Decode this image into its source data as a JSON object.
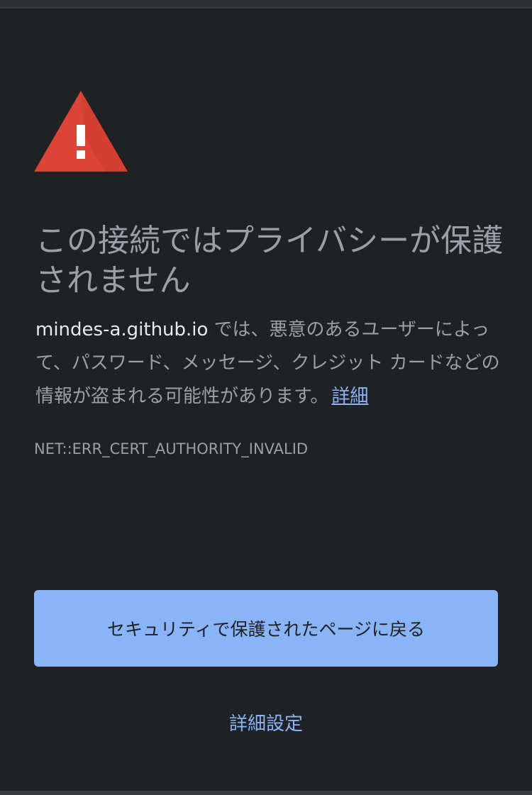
{
  "header": {
    "title": "この接続ではプライバシーが保護されません"
  },
  "message": {
    "host": "mindes-a.github.io",
    "text": "では、悪意のあるユーザーによって、パスワード、メッセージ、クレジット カードなどの情報が盗まれる可能性があります。",
    "details_link": "詳細"
  },
  "error_code": "NET::ERR_CERT_AUTHORITY_INVALID",
  "actions": {
    "back_to_safety": "セキュリティで保護されたページに戻る",
    "advanced": "詳細設定"
  },
  "icons": {
    "warning": "warning-triangle-icon"
  },
  "colors": {
    "background": "#202124",
    "warning_red": "#db4437",
    "primary_button": "#8ab4f8",
    "link": "#8ab4f8",
    "text_secondary": "#9aa0a6",
    "text_primary": "#e8eaed"
  }
}
